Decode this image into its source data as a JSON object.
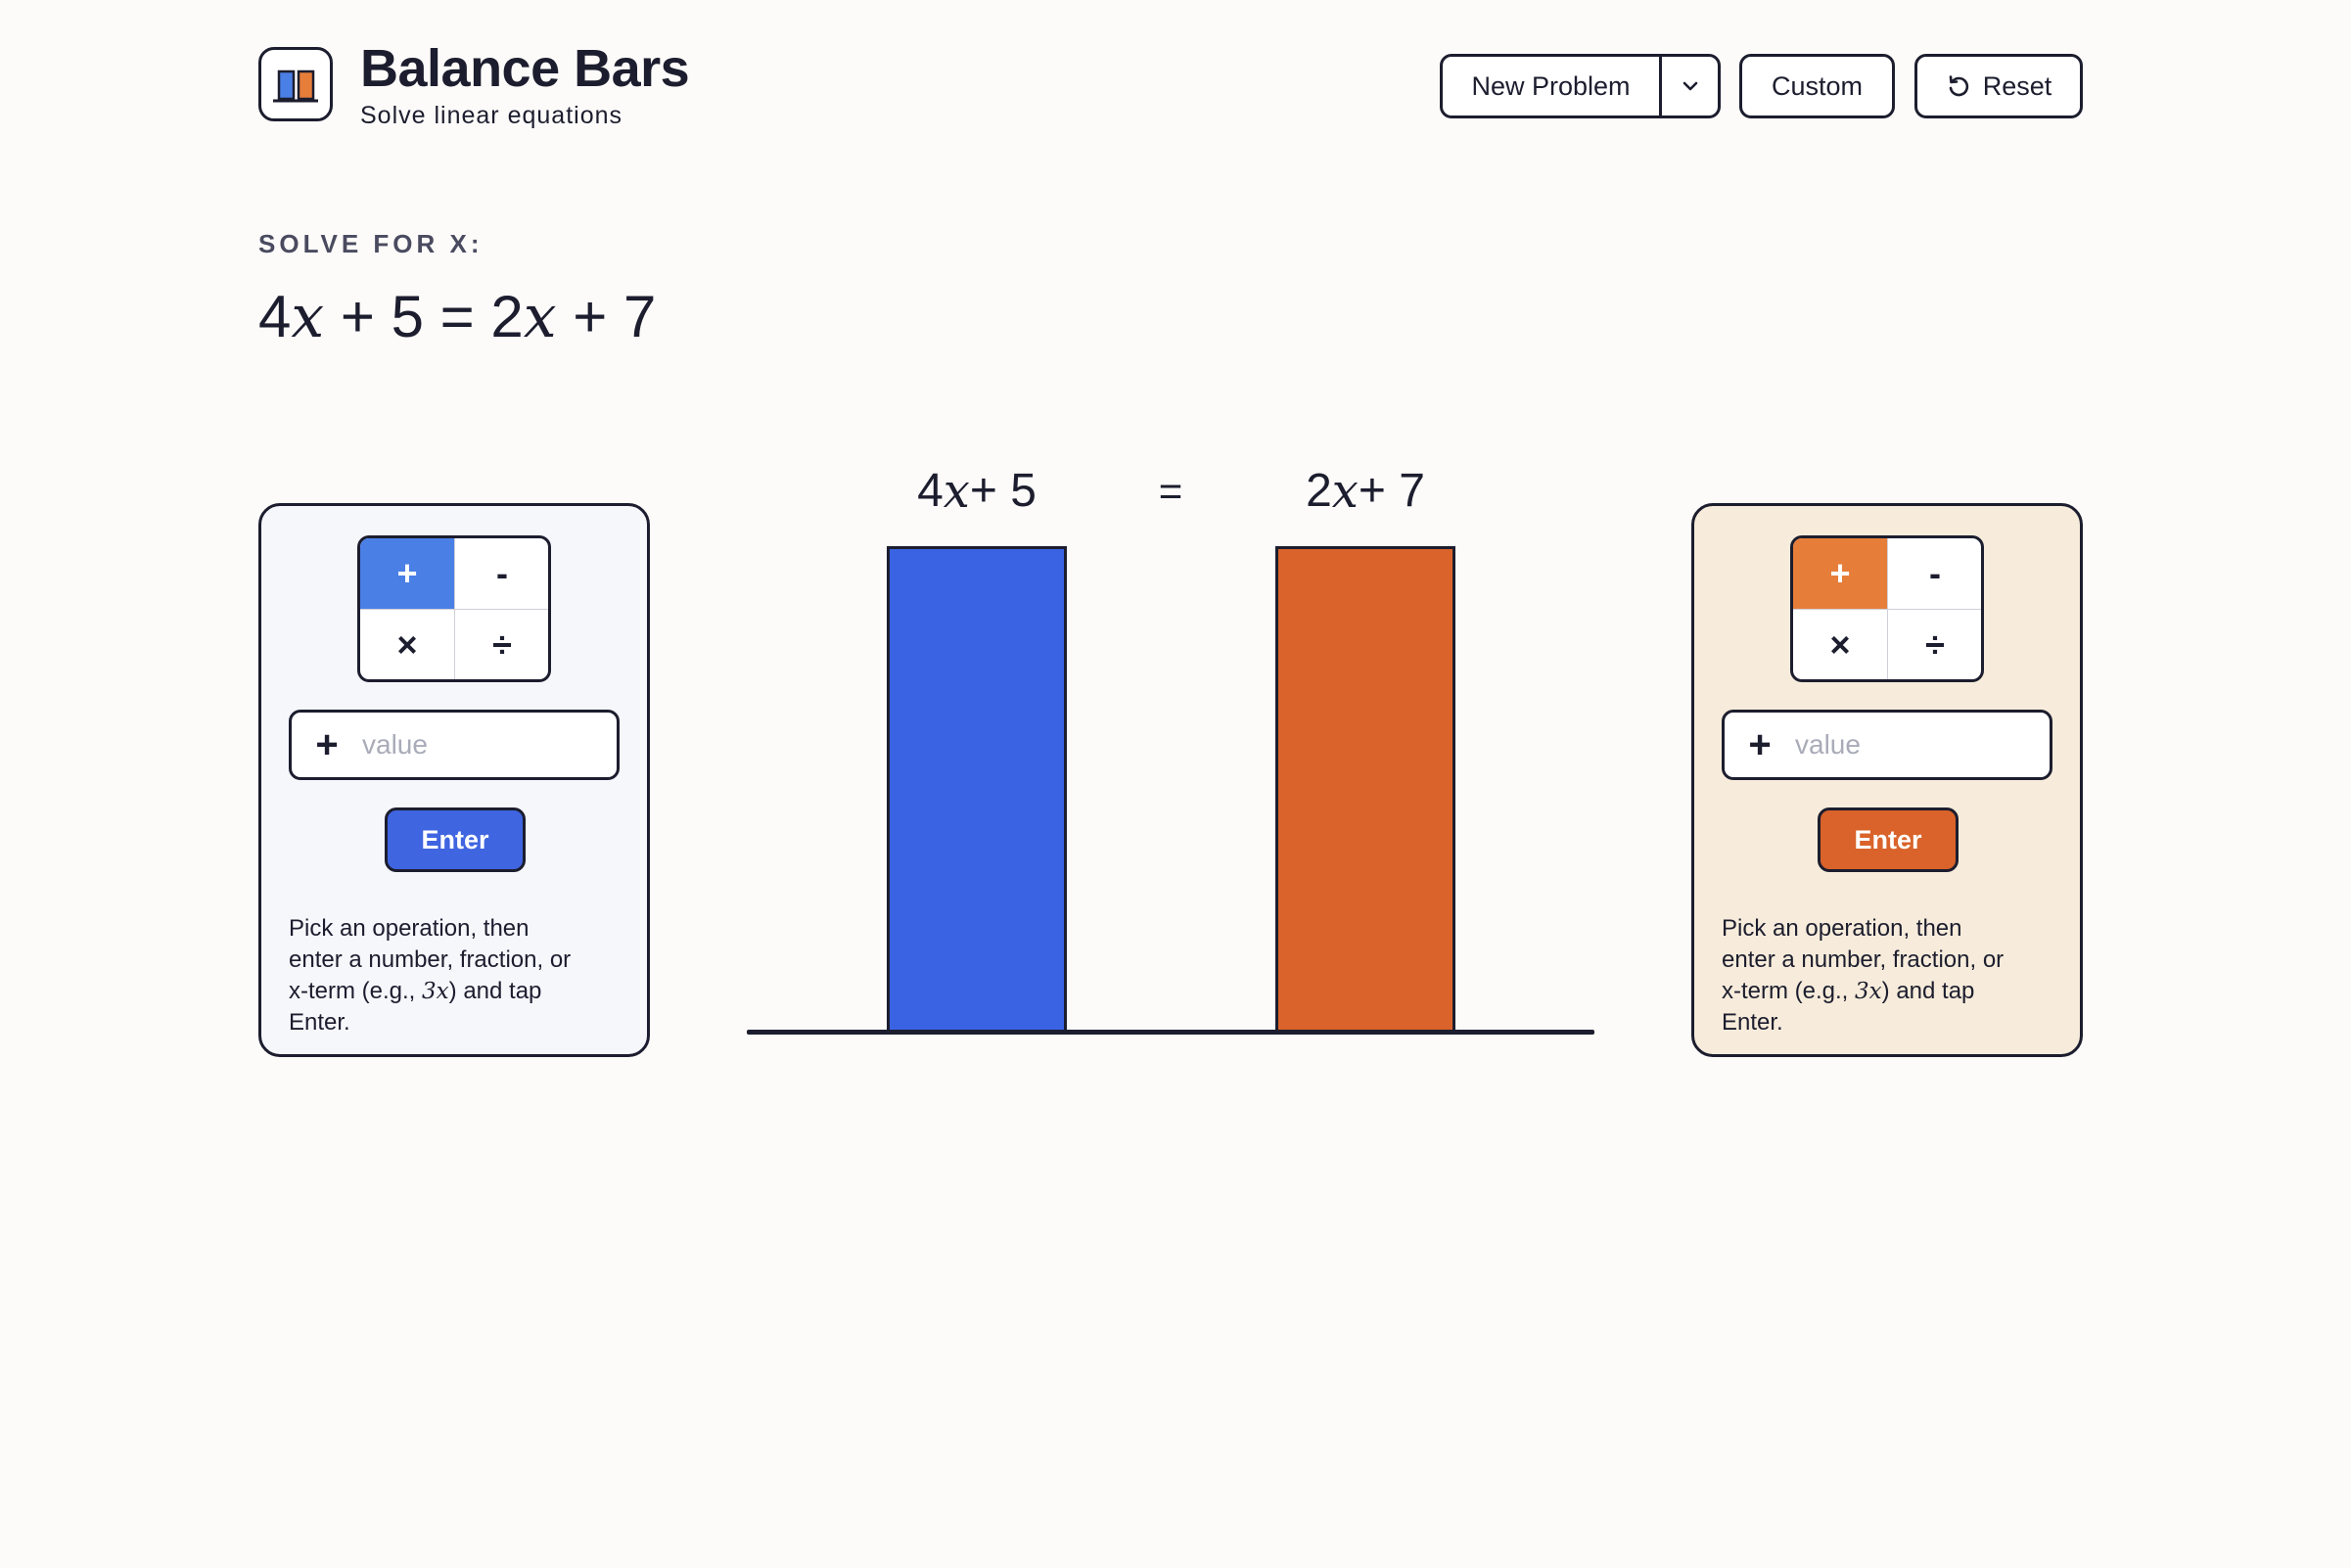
{
  "app": {
    "title": "Balance Bars",
    "subtitle": "Solve linear equations",
    "logo_icon": "balance-bars-logo"
  },
  "toolbar": {
    "new_problem_label": "New Problem",
    "dropdown_icon": "chevron-down-icon",
    "custom_label": "Custom",
    "reset_label": "Reset",
    "reset_icon": "refresh-icon"
  },
  "problem": {
    "label": "SOLVE FOR X:",
    "equation": {
      "left_coef": "4",
      "left_var": "x",
      "left_rest": " + 5",
      "equals": " = ",
      "right_coef": "2",
      "right_var": "x",
      "right_rest": " + 7"
    }
  },
  "balance": {
    "left_label": {
      "coef": "4",
      "var": "x",
      "rest": "+ 5"
    },
    "equals": "=",
    "right_label": {
      "coef": "2",
      "var": "x",
      "rest": "+ 7"
    }
  },
  "left_panel": {
    "operations": [
      "+",
      "-",
      "×",
      "÷"
    ],
    "selected_operation": "+",
    "value_operator": "+",
    "value_placeholder": "value",
    "enter_label": "Enter",
    "help": {
      "before": "Pick an operation, then enter a number, fraction, or x-term (e.g., ",
      "example_coef": "3",
      "example_var": "x",
      "after": ") and tap Enter."
    }
  },
  "right_panel": {
    "operations": [
      "+",
      "-",
      "×",
      "÷"
    ],
    "selected_operation": "+",
    "value_operator": "+",
    "value_placeholder": "value",
    "enter_label": "Enter",
    "help": {
      "before": "Pick an operation, then enter a number, fraction, or x-term (e.g., ",
      "example_coef": "3",
      "example_var": "x",
      "after": ") and tap Enter."
    }
  },
  "colors": {
    "left_accent": "#3a63e4",
    "left_active_op": "#4a7fe6",
    "right_accent": "#d9632a",
    "right_active_op": "#e67e3a",
    "left_panel_bg": "#f5f7fb",
    "right_panel_bg": "#f7ecdb",
    "ink": "#1c1d2e"
  }
}
